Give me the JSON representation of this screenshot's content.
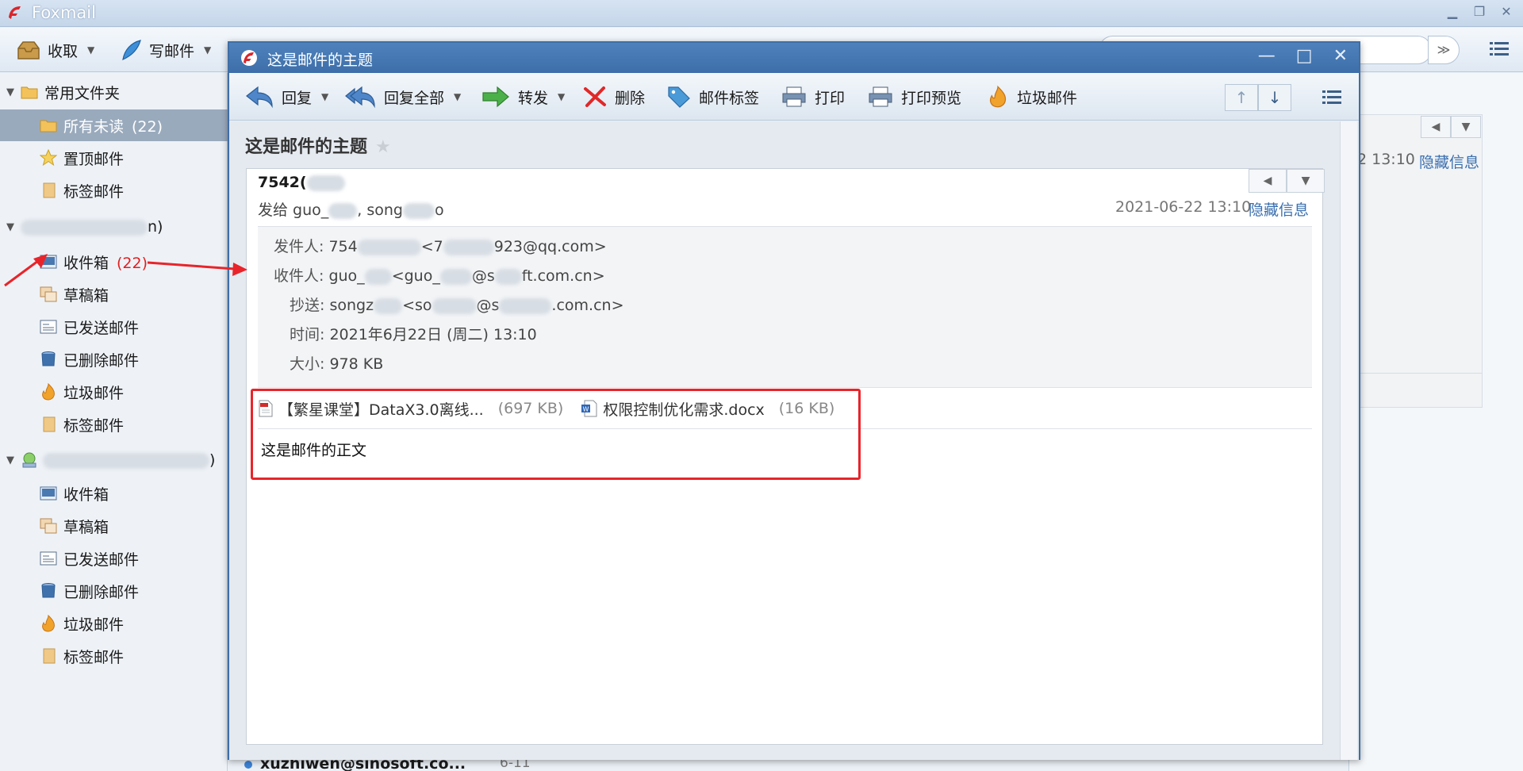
{
  "app": {
    "title": "Foxmail"
  },
  "toolbar": {
    "receive": "收取",
    "compose": "写邮件"
  },
  "sidebar": {
    "favorites_header": "常用文件夹",
    "favorites": [
      {
        "label": "所有未读",
        "count": "(22)"
      },
      {
        "label": "置顶邮件"
      },
      {
        "label": "标签邮件"
      }
    ],
    "account1_suffix": "n)",
    "account1_folders": [
      {
        "label": "收件箱",
        "count": "(22)"
      },
      {
        "label": "草稿箱"
      },
      {
        "label": "已发送邮件"
      },
      {
        "label": "已删除邮件"
      },
      {
        "label": "垃圾邮件"
      },
      {
        "label": "标签邮件"
      }
    ],
    "account2_suffix": ")",
    "account2_folders": [
      {
        "label": "收件箱"
      },
      {
        "label": "草稿箱"
      },
      {
        "label": "已发送邮件"
      },
      {
        "label": "已删除邮件"
      },
      {
        "label": "垃圾邮件"
      },
      {
        "label": "标签邮件"
      }
    ]
  },
  "background_pane": {
    "time": "2 13:10",
    "hide_info": "隐藏信息"
  },
  "background_list": {
    "sender": "xuzhiwen@sinosoft.co...",
    "date": "6-11"
  },
  "message_window": {
    "title": "这是邮件的主题",
    "toolbar": {
      "reply": "回复",
      "reply_all": "回复全部",
      "forward": "转发",
      "delete": "删除",
      "tag": "邮件标签",
      "print": "打印",
      "print_preview": "打印预览",
      "junk": "垃圾邮件"
    },
    "subject": "这是邮件的主题",
    "sender_short": "7542(",
    "to_prefix": "发给 guo_",
    "to_mid": ", song",
    "to_end": "o",
    "date": "2021-06-22 13:10",
    "hide_info": "隐藏信息",
    "headers": {
      "from_label": "发件人:",
      "from_value_start": "754",
      "from_value_mid": "<7",
      "from_value_end": "923@qq.com>",
      "to_label": "收件人:",
      "to_value_start": "guo_",
      "to_value_mid": "<guo_",
      "to_value_mid2": "@s",
      "to_value_end": "ft.com.cn>",
      "cc_label": "抄送:",
      "cc_value_start": "songz",
      "cc_value_mid": "<so",
      "cc_value_mid2": "@s",
      "cc_value_end": ".com.cn>",
      "time_label": "时间:",
      "time_value": "2021年6月22日 (周二) 13:10",
      "size_label": "大小:",
      "size_value": "978 KB"
    },
    "attachments": [
      {
        "name": "【繁星课堂】DataX3.0离线...",
        "size": "(697 KB)"
      },
      {
        "name": "权限控制优化需求.docx",
        "size": "(16 KB)"
      }
    ],
    "body": "这是邮件的正文"
  }
}
